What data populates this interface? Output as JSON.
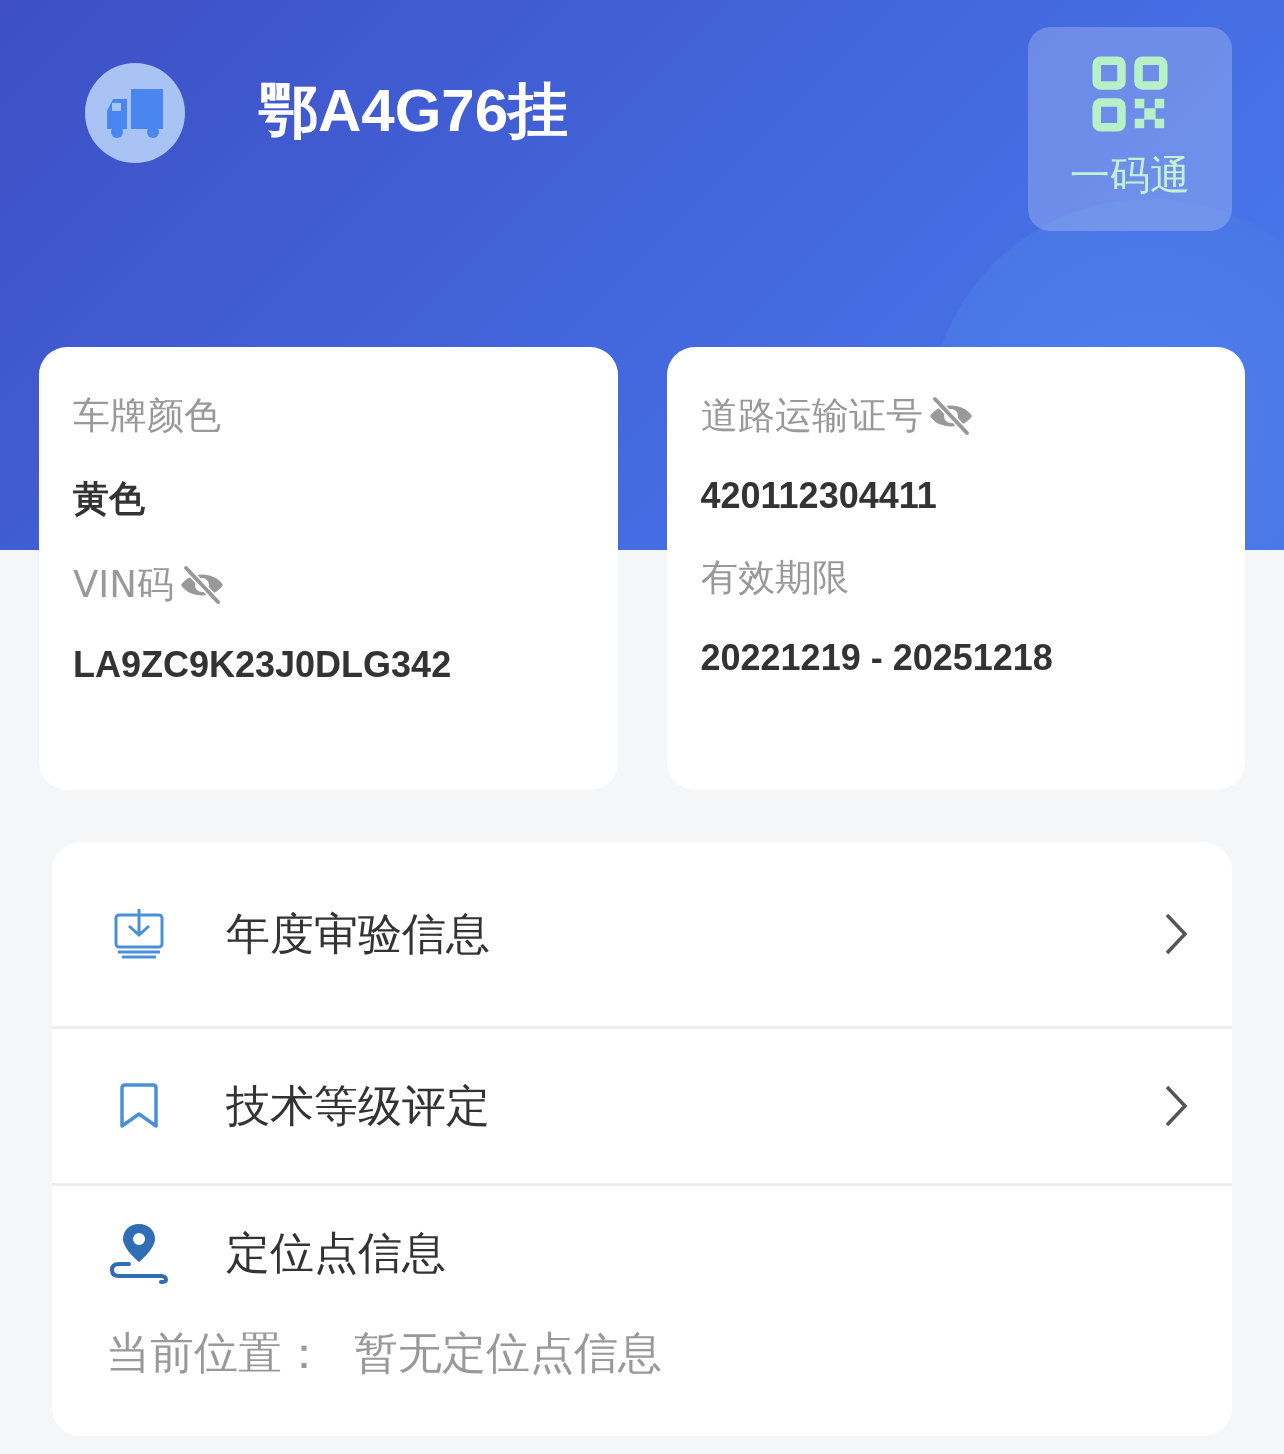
{
  "header": {
    "plate": "鄂A4G76挂",
    "qr_button": {
      "label": "一码通"
    }
  },
  "cards": [
    {
      "fields": [
        {
          "label": "车牌颜色",
          "masked": false,
          "value": "黄色"
        },
        {
          "label": "VIN码",
          "masked": true,
          "value": "LA9ZC9K23J0DLG342"
        }
      ]
    },
    {
      "fields": [
        {
          "label": "道路运输证号",
          "masked": true,
          "value": "420112304411"
        },
        {
          "label": "有效期限",
          "masked": false,
          "value": "20221219 - 20251218"
        }
      ]
    }
  ],
  "menu": [
    {
      "kind": "link",
      "label": "年度审验信息"
    },
    {
      "kind": "link",
      "label": "技术等级评定"
    },
    {
      "kind": "location",
      "label": "定位点信息",
      "sub_label": "当前位置：",
      "sub_value": "暂无定位点信息"
    }
  ]
}
